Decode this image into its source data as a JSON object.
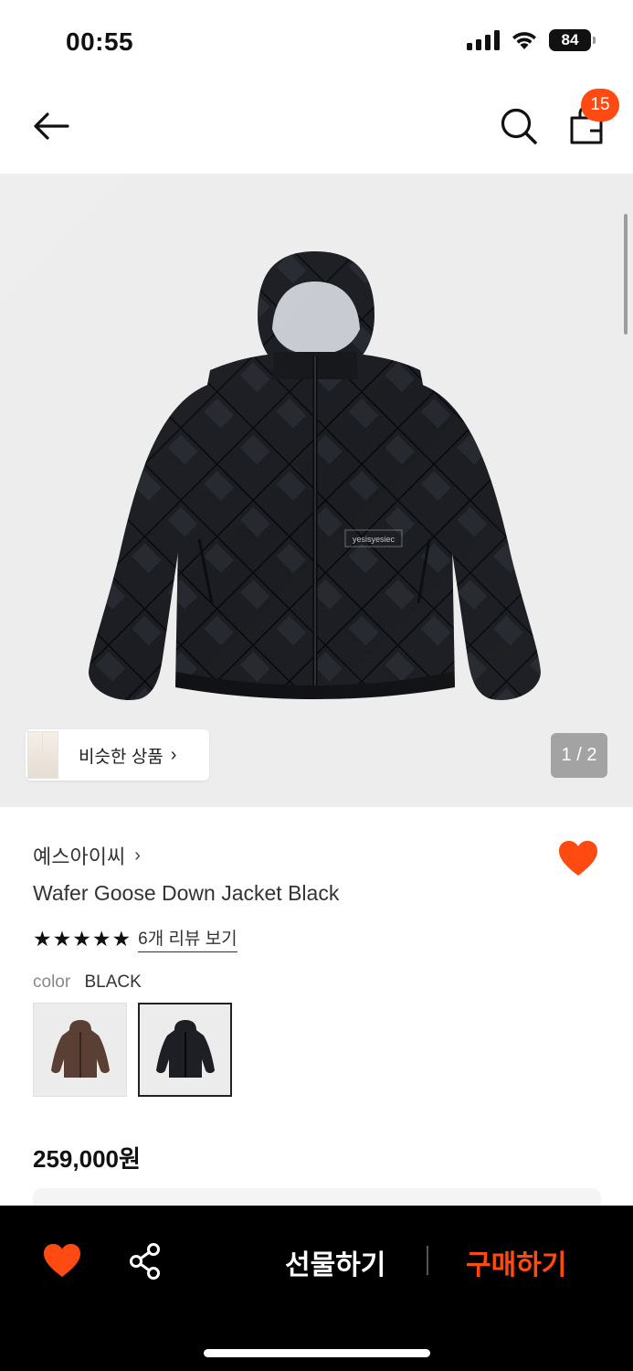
{
  "status_bar": {
    "time": "00:55",
    "battery": "84"
  },
  "header": {
    "cart_count": "15"
  },
  "hero": {
    "similar_label": "비슷한 상품",
    "page_indicator": "1 / 2"
  },
  "product": {
    "brand": "예스아이씨",
    "title": "Wafer Goose Down Jacket Black",
    "rating_stars": 5,
    "review_link": "6개 리뷰 보기",
    "color_label": "color",
    "color_value": "BLACK",
    "swatches": [
      {
        "color": "#5a4034",
        "selected": false
      },
      {
        "color": "#1d1f24",
        "selected": true
      }
    ],
    "price": "259,000원"
  },
  "bottom_bar": {
    "gift_label": "선물하기",
    "buy_label": "구매하기"
  },
  "colors": {
    "accent": "#ff4b12",
    "bar": "#000000"
  }
}
